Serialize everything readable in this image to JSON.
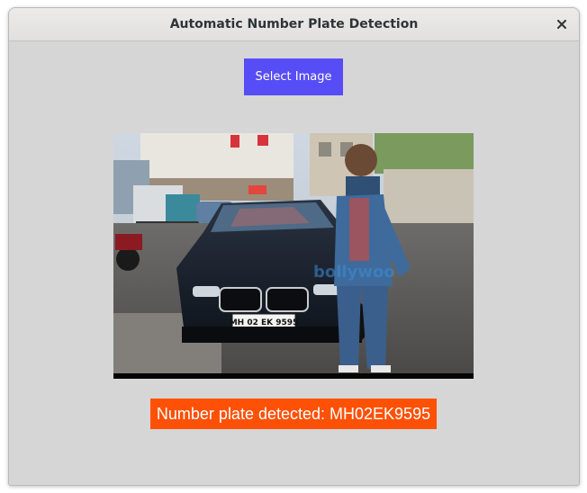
{
  "window": {
    "title": "Automatic Number Plate Detection",
    "close_icon": "close-icon"
  },
  "main": {
    "select_button_label": "Select Image",
    "image": {
      "description_icon": "photo",
      "plate_text": "MH 02 EK 9595"
    },
    "result_text": "Number plate detected: MH02EK9595"
  },
  "colors": {
    "button": "#574df6",
    "result": "#fe5106",
    "window_bg": "#d6d6d6"
  }
}
